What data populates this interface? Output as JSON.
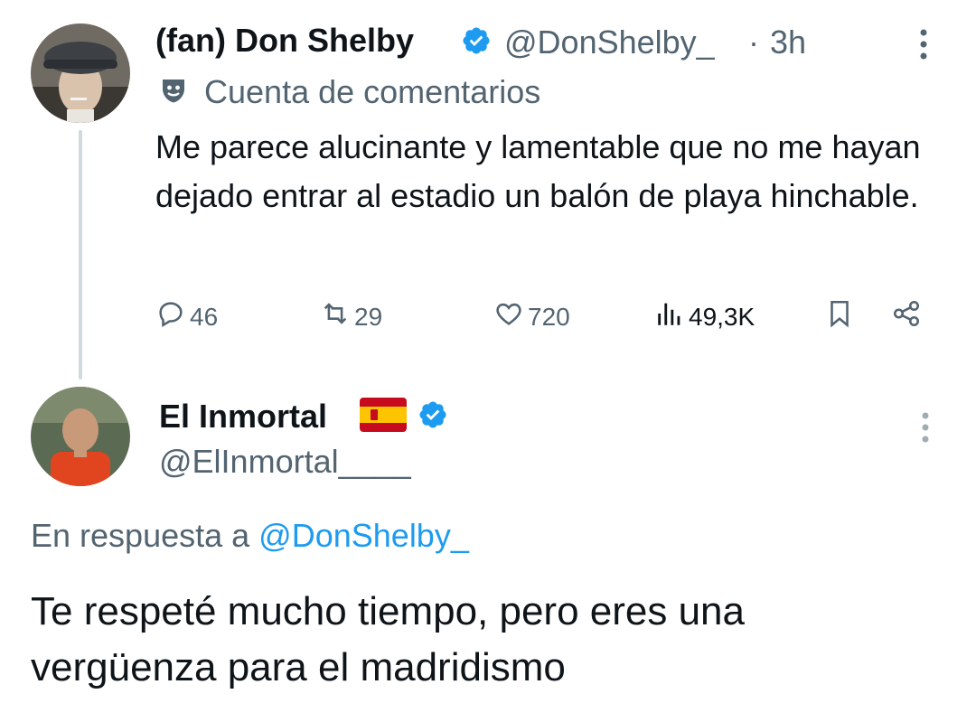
{
  "tweet1": {
    "display_name": "(fan) Don Shelby",
    "handle": "@DonShelby_",
    "separator": "·",
    "time": "3h",
    "label": "Cuenta de comentarios",
    "text": "Me parece alucinante y lamentable que no me hayan dejado entrar al estadio un balón de playa hinchable.",
    "actions": {
      "replies": "46",
      "reposts": "29",
      "likes": "720",
      "views": "49,3K"
    }
  },
  "tweet2": {
    "display_name": "El Inmortal",
    "handle": "@ElInmortal____",
    "reply_prefix": "En respuesta a",
    "reply_to": "@DonShelby_",
    "text": "Te respeté mucho tiempo, pero eres una vergüenza para el madridismo"
  },
  "icons": {
    "verified": "verified-badge-icon",
    "mask": "theater-mask-icon",
    "more": "more-vertical-icon",
    "reply": "reply-icon",
    "repost": "repost-icon",
    "like": "heart-icon",
    "views": "views-chart-icon",
    "bookmark": "bookmark-icon",
    "share": "share-icon",
    "flag": "spain-flag-icon"
  },
  "colors": {
    "accent": "#1d9bf0",
    "muted": "#536471",
    "text": "#0f1419",
    "thread_line": "#cfd9de"
  }
}
